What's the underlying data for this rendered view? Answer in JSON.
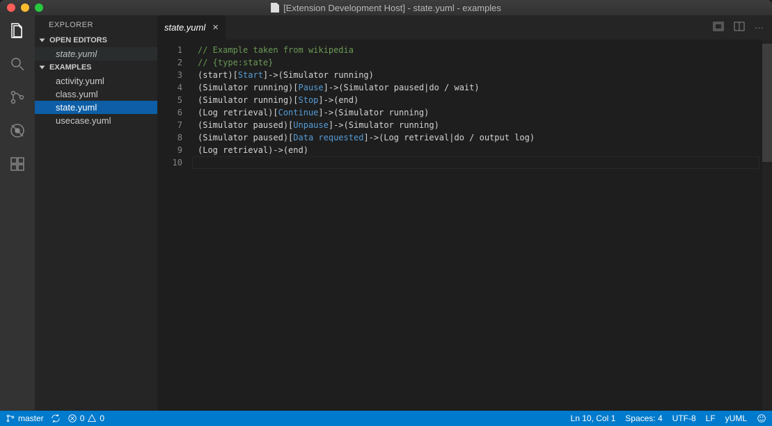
{
  "window": {
    "title": "[Extension Development Host] - state.yuml - examples"
  },
  "sidebar": {
    "title": "EXPLORER",
    "sections": {
      "open_editors": {
        "label": "OPEN EDITORS",
        "items": [
          "state.yuml"
        ]
      },
      "examples": {
        "label": "EXAMPLES",
        "items": [
          "activity.yuml",
          "class.yuml",
          "state.yuml",
          "usecase.yuml"
        ],
        "selected": "state.yuml"
      }
    }
  },
  "tabs": {
    "active": "state.yuml"
  },
  "editor": {
    "lines": [
      {
        "n": 1,
        "segs": [
          {
            "t": "// Example taken from wikipedia",
            "cls": "tok-comment"
          }
        ]
      },
      {
        "n": 2,
        "segs": [
          {
            "t": "// {type:state}",
            "cls": "tok-comment"
          }
        ]
      },
      {
        "n": 3,
        "segs": [
          {
            "t": "(start)[",
            "cls": "tok-plain"
          },
          {
            "t": "Start",
            "cls": "tok-bracket"
          },
          {
            "t": "]->(Simulator running)",
            "cls": "tok-plain"
          }
        ]
      },
      {
        "n": 4,
        "segs": [
          {
            "t": "(Simulator running)[",
            "cls": "tok-plain"
          },
          {
            "t": "Pause",
            "cls": "tok-bracket"
          },
          {
            "t": "]->(Simulator paused|do / wait)",
            "cls": "tok-plain"
          }
        ]
      },
      {
        "n": 5,
        "segs": [
          {
            "t": "(Simulator running)[",
            "cls": "tok-plain"
          },
          {
            "t": "Stop",
            "cls": "tok-bracket"
          },
          {
            "t": "]->(end)",
            "cls": "tok-plain"
          }
        ]
      },
      {
        "n": 6,
        "segs": [
          {
            "t": "(Log retrieval)[",
            "cls": "tok-plain"
          },
          {
            "t": "Continue",
            "cls": "tok-bracket"
          },
          {
            "t": "]->(Simulator running)",
            "cls": "tok-plain"
          }
        ]
      },
      {
        "n": 7,
        "segs": [
          {
            "t": "(Simulator paused)[",
            "cls": "tok-plain"
          },
          {
            "t": "Unpause",
            "cls": "tok-bracket"
          },
          {
            "t": "]->(Simulator running)",
            "cls": "tok-plain"
          }
        ]
      },
      {
        "n": 8,
        "segs": [
          {
            "t": "(Simulator paused)[",
            "cls": "tok-plain"
          },
          {
            "t": "Data requested",
            "cls": "tok-bracket"
          },
          {
            "t": "]->(Log retrieval|do / output log)",
            "cls": "tok-plain"
          }
        ]
      },
      {
        "n": 9,
        "segs": [
          {
            "t": "(Log retrieval)->(end)",
            "cls": "tok-plain"
          }
        ]
      },
      {
        "n": 10,
        "segs": []
      }
    ]
  },
  "statusbar": {
    "branch": "master",
    "errors": "0",
    "warnings": "0",
    "position": "Ln 10, Col 1",
    "spaces": "Spaces: 4",
    "encoding": "UTF-8",
    "eol": "LF",
    "language": "yUML"
  }
}
